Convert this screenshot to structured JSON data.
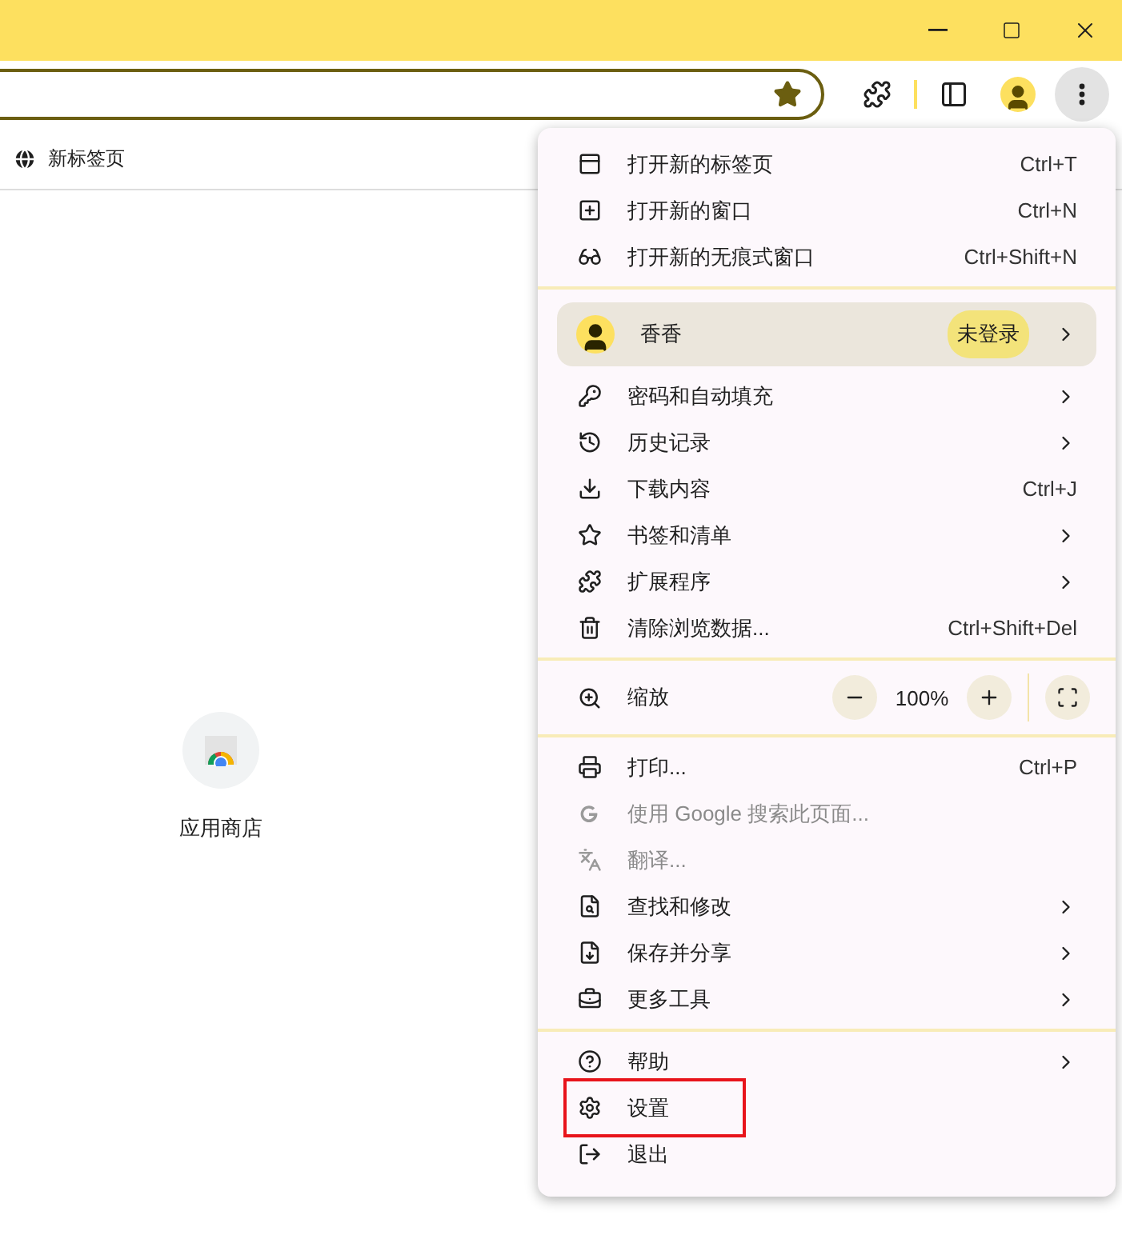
{
  "toolbar": {
    "bookmarked": true,
    "menu_open": true
  },
  "bookmarks_bar": {
    "items": [
      {
        "label": "新标签页"
      }
    ]
  },
  "shortcuts": [
    {
      "label": "应用商店"
    }
  ],
  "menu": {
    "sections": [
      {
        "items": [
          {
            "kind": "new-tab",
            "label": "打开新的标签页",
            "shortcut": "Ctrl+T",
            "submenu": false,
            "disabled": false,
            "highlighted": false
          },
          {
            "kind": "new-window",
            "label": "打开新的窗口",
            "shortcut": "Ctrl+N",
            "submenu": false,
            "disabled": false,
            "highlighted": false
          },
          {
            "kind": "incognito",
            "label": "打开新的无痕式窗口",
            "shortcut": "Ctrl+Shift+N",
            "submenu": false,
            "disabled": false,
            "highlighted": false
          }
        ]
      },
      {
        "items": [
          {
            "kind": "profile",
            "label": "香香",
            "badge": "未登录",
            "submenu": true
          },
          {
            "kind": "key",
            "label": "密码和自动填充",
            "submenu": true,
            "disabled": false,
            "highlighted": false
          },
          {
            "kind": "history",
            "label": "历史记录",
            "submenu": true,
            "disabled": false,
            "highlighted": false
          },
          {
            "kind": "download",
            "label": "下载内容",
            "shortcut": "Ctrl+J",
            "submenu": false,
            "disabled": false,
            "highlighted": false
          },
          {
            "kind": "star",
            "label": "书签和清单",
            "submenu": true,
            "disabled": false,
            "highlighted": false
          },
          {
            "kind": "puzzle",
            "label": "扩展程序",
            "submenu": true,
            "disabled": false,
            "highlighted": false
          },
          {
            "kind": "trash",
            "label": "清除浏览数据...",
            "shortcut": "Ctrl+Shift+Del",
            "submenu": false,
            "disabled": false,
            "highlighted": false
          }
        ]
      },
      {
        "items": [
          {
            "kind": "zoom",
            "label": "缩放",
            "value": "100%"
          }
        ]
      },
      {
        "items": [
          {
            "kind": "print",
            "label": "打印...",
            "shortcut": "Ctrl+P",
            "submenu": false,
            "disabled": false,
            "highlighted": false
          },
          {
            "kind": "google",
            "label": "使用 Google 搜索此页面...",
            "submenu": false,
            "disabled": true,
            "highlighted": false
          },
          {
            "kind": "translate",
            "label": "翻译...",
            "submenu": false,
            "disabled": true,
            "highlighted": false
          },
          {
            "kind": "find",
            "label": "查找和修改",
            "submenu": true,
            "disabled": false,
            "highlighted": false
          },
          {
            "kind": "save",
            "label": "保存并分享",
            "submenu": true,
            "disabled": false,
            "highlighted": false
          },
          {
            "kind": "tools",
            "label": "更多工具",
            "submenu": true,
            "disabled": false,
            "highlighted": false
          }
        ]
      },
      {
        "items": [
          {
            "kind": "help",
            "label": "帮助",
            "submenu": true,
            "disabled": false,
            "highlighted": false
          },
          {
            "kind": "settings",
            "label": "设置",
            "submenu": false,
            "disabled": false,
            "highlighted": true
          },
          {
            "kind": "exit",
            "label": "退出",
            "submenu": false,
            "disabled": false,
            "highlighted": false
          }
        ]
      }
    ]
  }
}
